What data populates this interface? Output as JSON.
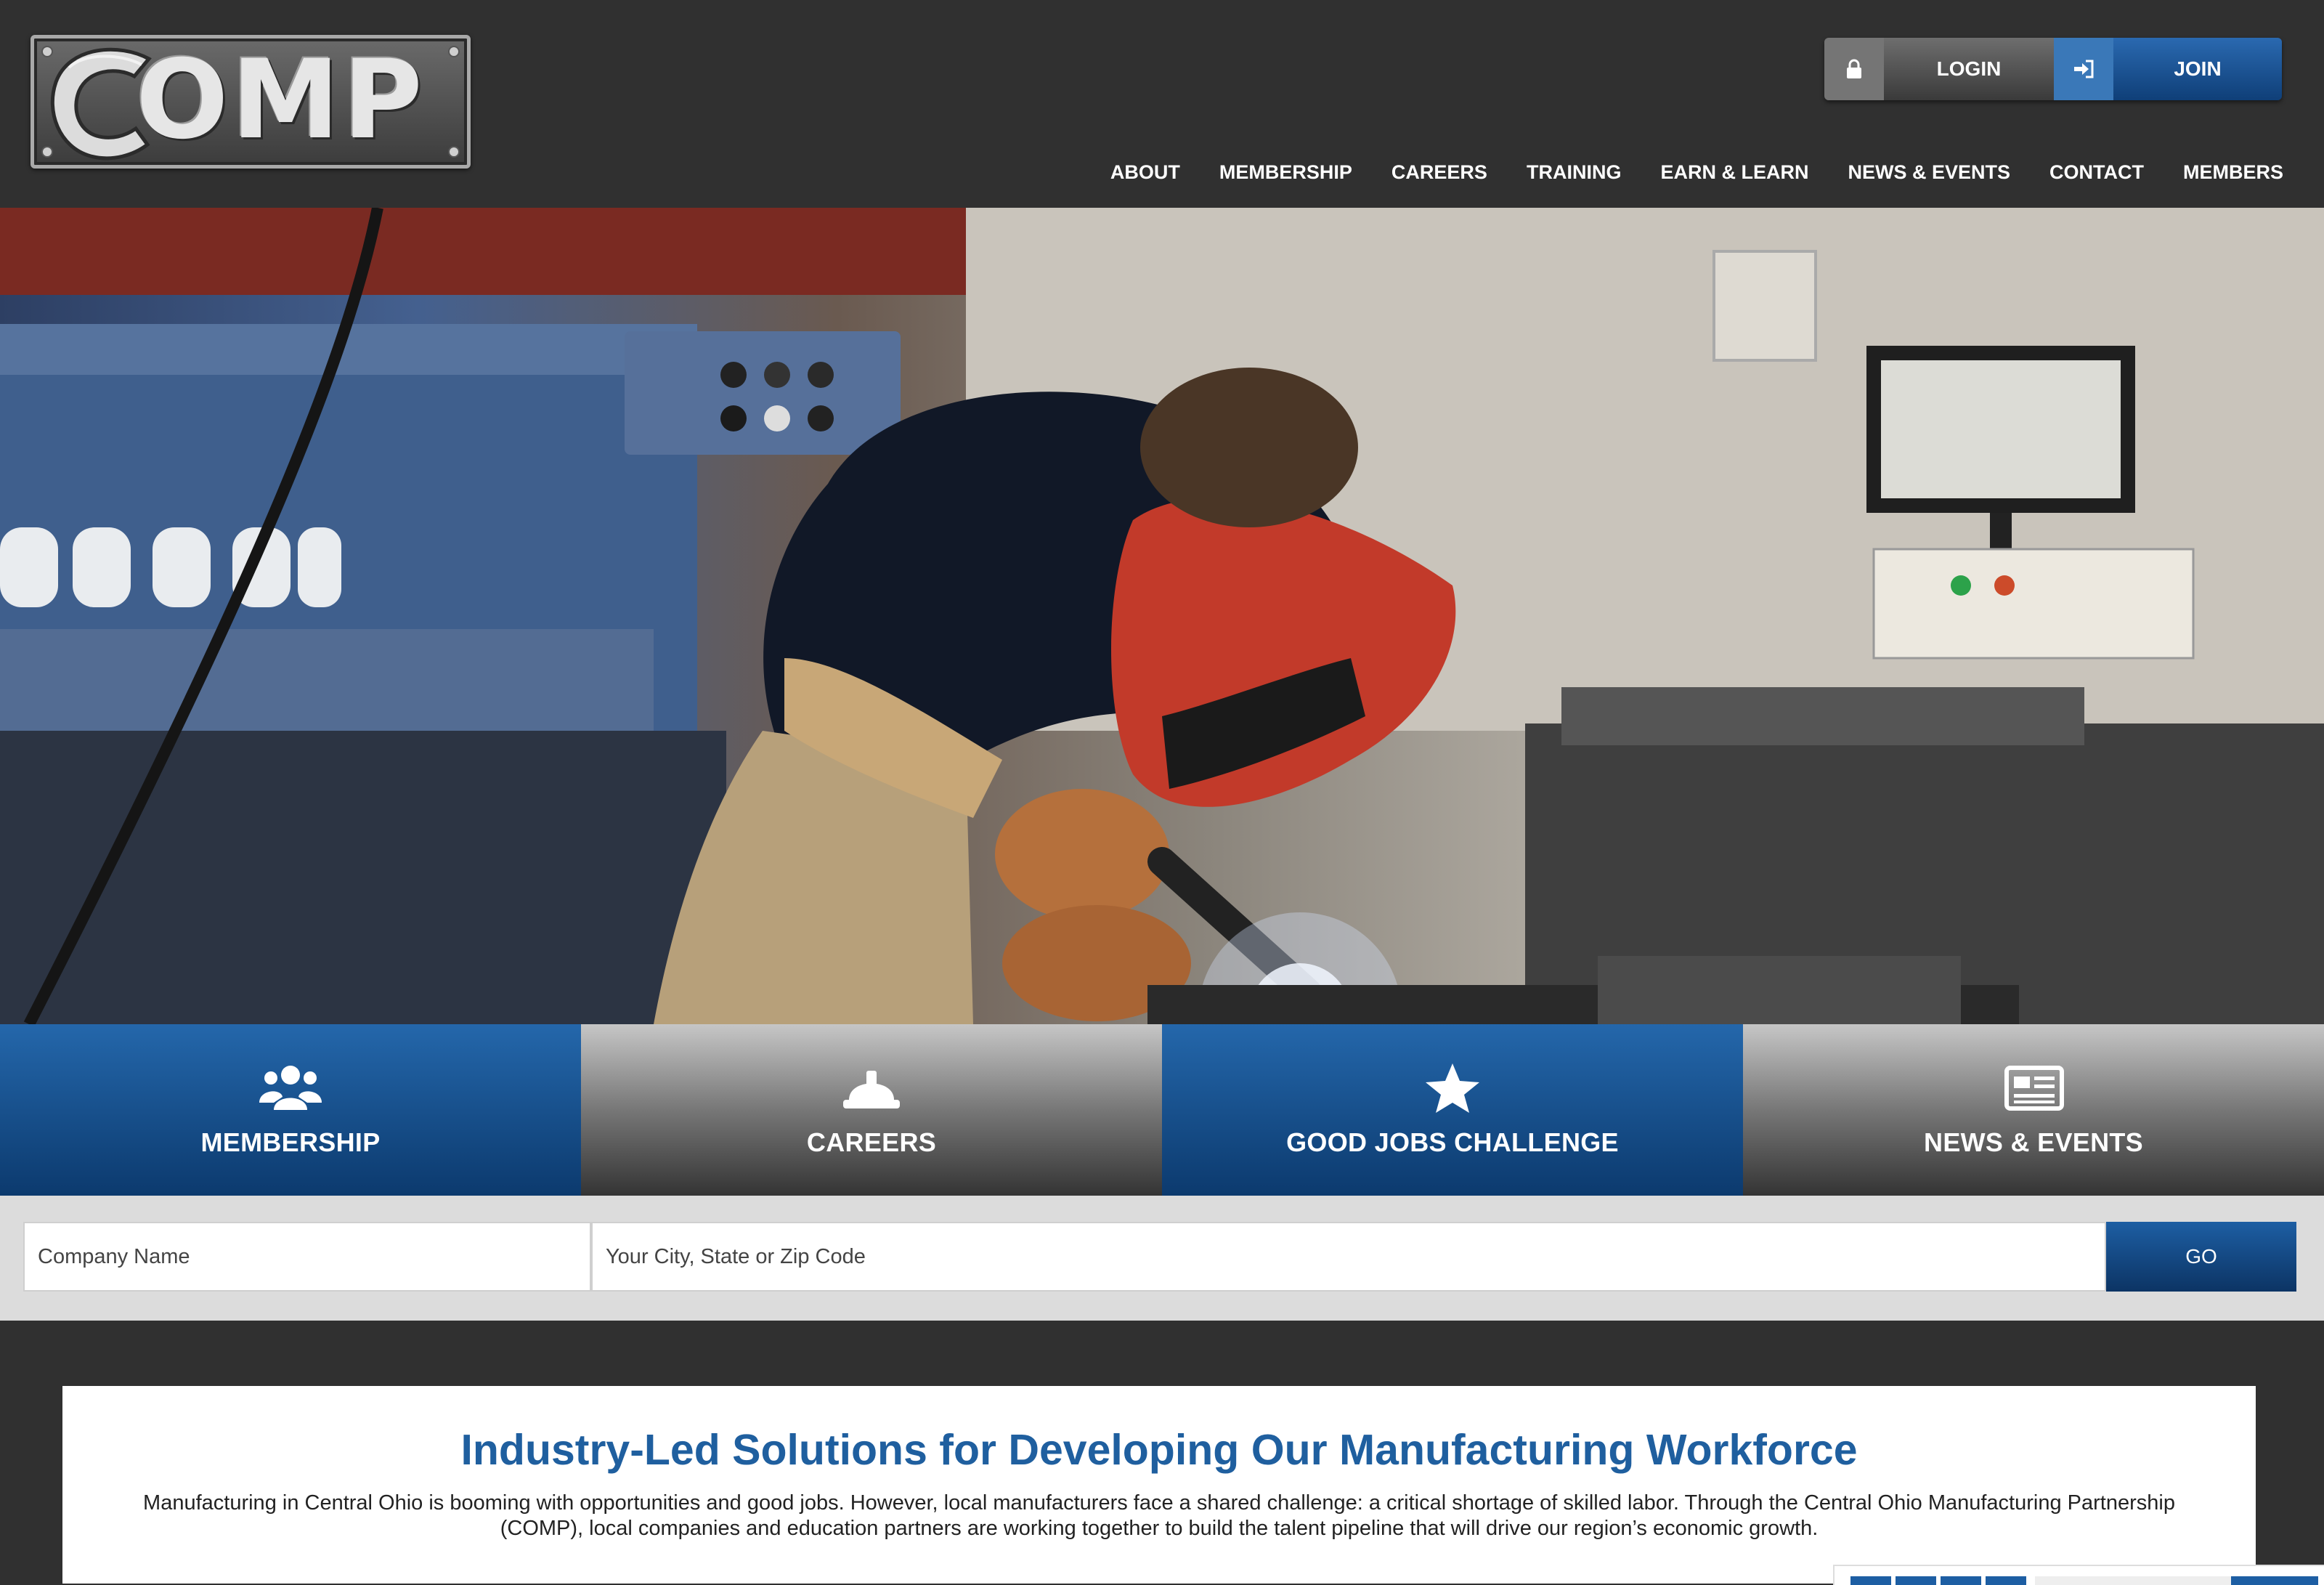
{
  "brand": {
    "logo_text": "OMP"
  },
  "auth": {
    "login_label": "LOGIN",
    "join_label": "JOIN"
  },
  "nav": {
    "items": [
      {
        "label": "ABOUT"
      },
      {
        "label": "MEMBERSHIP"
      },
      {
        "label": "CAREERS"
      },
      {
        "label": "TRAINING"
      },
      {
        "label": "EARN & LEARN"
      },
      {
        "label": "NEWS & EVENTS"
      },
      {
        "label": "CONTACT"
      },
      {
        "label": "MEMBERS"
      }
    ]
  },
  "tiles": [
    {
      "label": "MEMBERSHIP",
      "icon": "users-icon"
    },
    {
      "label": "CAREERS",
      "icon": "hard-hat-icon"
    },
    {
      "label": "GOOD JOBS CHALLENGE",
      "icon": "star-icon"
    },
    {
      "label": "NEWS & EVENTS",
      "icon": "newspaper-icon"
    }
  ],
  "search": {
    "company_placeholder": "Company Name",
    "location_placeholder": "Your City, State or Zip Code",
    "go_label": "GO"
  },
  "content": {
    "headline": "Industry-Led Solutions for Developing Our Manufacturing Workforce",
    "intro": "Manufacturing in Central Ohio is booming with opportunities and good jobs. However, local manufacturers face a shared challenge: a critical shortage of skilled labor. Through the Central Ohio Manufacturing Partnership (COMP), local companies and education partners are working together to build the talent pipeline that will drive our region’s economic growth."
  },
  "colors": {
    "accent": "#1f5f9f",
    "header_bg": "#303030",
    "tile_blue": "#1a5597"
  }
}
